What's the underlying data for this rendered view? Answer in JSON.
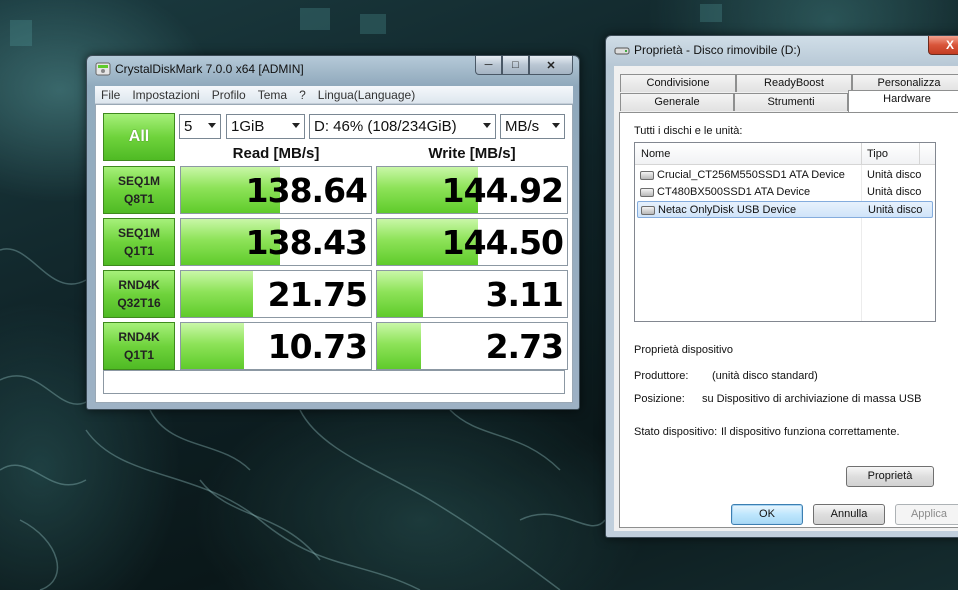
{
  "cdm": {
    "title": "CrystalDiskMark 7.0.0 x64 [ADMIN]",
    "menu": [
      "File",
      "Impostazioni",
      "Profilo",
      "Tema",
      "?",
      "Lingua(Language)"
    ],
    "all_label": "All",
    "count": "5",
    "size": "1GiB",
    "drive": "D: 46% (108/234GiB)",
    "unit": "MB/s",
    "read_header": "Read [MB/s]",
    "write_header": "Write [MB/s]",
    "tests": [
      {
        "l1": "SEQ1M",
        "l2": "Q8T1",
        "read": "138.64",
        "write": "144.92",
        "read_fill": 0.52,
        "write_fill": 0.53
      },
      {
        "l1": "SEQ1M",
        "l2": "Q1T1",
        "read": "138.43",
        "write": "144.50",
        "read_fill": 0.52,
        "write_fill": 0.53
      },
      {
        "l1": "RND4K",
        "l2": "Q32T16",
        "read": "21.75",
        "write": "3.11",
        "read_fill": 0.38,
        "write_fill": 0.24
      },
      {
        "l1": "RND4K",
        "l2": "Q1T1",
        "read": "10.73",
        "write": "2.73",
        "read_fill": 0.33,
        "write_fill": 0.23
      }
    ]
  },
  "props": {
    "title": "Proprietà - Disco rimovibile (D:)",
    "close": "X",
    "tabs_row1": [
      "Condivisione",
      "ReadyBoost",
      "Personalizza"
    ],
    "tabs_row2": [
      "Generale",
      "Strumenti",
      "Hardware"
    ],
    "all_disks_label": "Tutti i dischi e le unità:",
    "col_name": "Nome",
    "col_type": "Tipo",
    "devices": [
      {
        "name": "Crucial_CT256M550SSD1 ATA Device",
        "type": "Unità disco"
      },
      {
        "name": "CT480BX500SSD1 ATA Device",
        "type": "Unità disco"
      },
      {
        "name": "Netac OnlyDisk USB Device",
        "type": "Unità disco"
      }
    ],
    "device_props_title": "Proprietà dispositivo",
    "producer_label": "Produttore:",
    "producer_value": "(unità disco standard)",
    "position_label": "Posizione:",
    "position_value": "su Dispositivo di archiviazione di massa USB",
    "status_label": "Stato dispositivo:",
    "status_value": "Il dispositivo funziona correttamente.",
    "properties_button": "Proprietà",
    "ok": "OK",
    "cancel": "Annulla",
    "apply": "Applica"
  },
  "colors": {
    "cdm_green": "#6fd33c",
    "selection_blue": "#d0e4f9",
    "close_red": "#d8553a"
  }
}
